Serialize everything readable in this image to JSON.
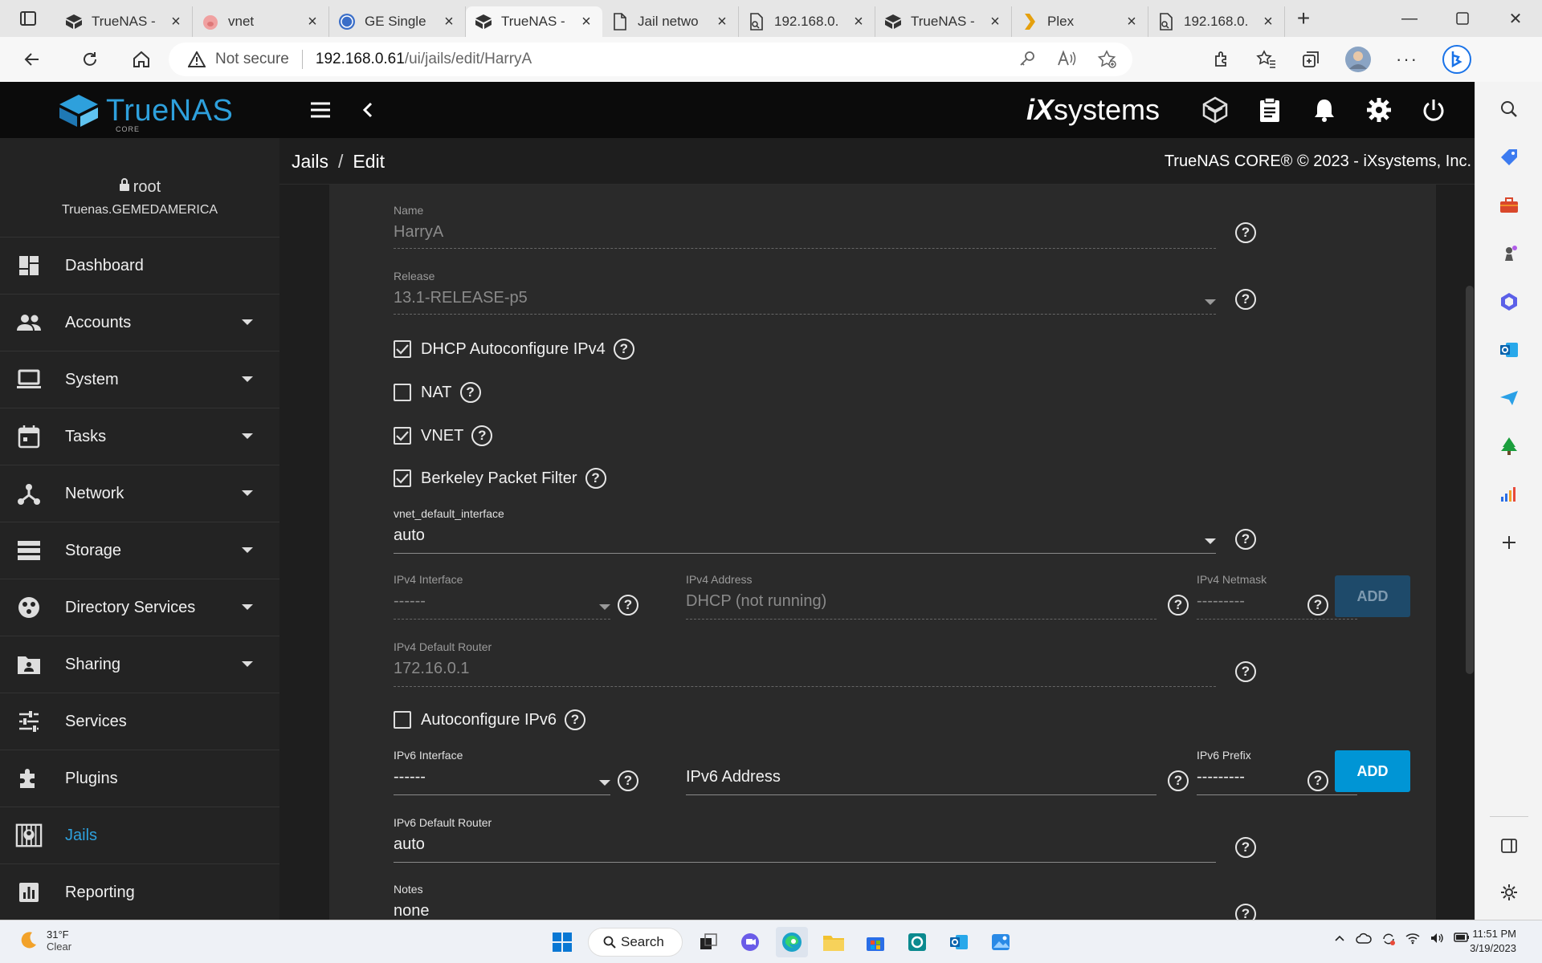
{
  "browser": {
    "tabs": [
      {
        "title": "TrueNAS - ",
        "icon": "truenas-icon",
        "active": false
      },
      {
        "title": "vnet",
        "icon": "pig-icon",
        "active": false
      },
      {
        "title": "GE Single",
        "icon": "ge-icon",
        "active": false
      },
      {
        "title": "TrueNAS - ",
        "icon": "truenas-icon",
        "active": true
      },
      {
        "title": "Jail netwo",
        "icon": "document-icon",
        "active": false
      },
      {
        "title": "192.168.0.",
        "icon": "broken-page-icon",
        "active": false
      },
      {
        "title": "TrueNAS - ",
        "icon": "truenas-icon",
        "active": false
      },
      {
        "title": "Plex",
        "icon": "plex-icon",
        "active": false
      },
      {
        "title": "192.168.0.",
        "icon": "broken-page-icon",
        "active": false
      }
    ],
    "security": "Not secure",
    "url_host": "192.168.0.61",
    "url_path": "/ui/jails/edit/HarryA"
  },
  "truenas": {
    "brand": "TrueNAS",
    "edition": "CORE",
    "vendor_logo_i": "iX",
    "vendor_logo_rest": "systems",
    "user": {
      "name": "root",
      "host": "Truenas.GEMEDAMERICA"
    },
    "nav": [
      {
        "label": "Dashboard",
        "icon": "dashboard-icon",
        "has_children": false
      },
      {
        "label": "Accounts",
        "icon": "accounts-icon",
        "has_children": true
      },
      {
        "label": "System",
        "icon": "system-icon",
        "has_children": true
      },
      {
        "label": "Tasks",
        "icon": "tasks-icon",
        "has_children": true
      },
      {
        "label": "Network",
        "icon": "network-icon",
        "has_children": true
      },
      {
        "label": "Storage",
        "icon": "storage-icon",
        "has_children": true
      },
      {
        "label": "Directory Services",
        "icon": "directory-services-icon",
        "has_children": true
      },
      {
        "label": "Sharing",
        "icon": "sharing-icon",
        "has_children": true
      },
      {
        "label": "Services",
        "icon": "services-icon",
        "has_children": false
      },
      {
        "label": "Plugins",
        "icon": "plugins-icon",
        "has_children": false
      },
      {
        "label": "Jails",
        "icon": "jails-icon",
        "has_children": false,
        "active": true
      },
      {
        "label": "Reporting",
        "icon": "reporting-icon",
        "has_children": false
      }
    ],
    "breadcrumb": {
      "parent": "Jails",
      "separator": "/",
      "current": "Edit"
    },
    "copyright": "TrueNAS CORE® © 2023 - iXsystems, Inc."
  },
  "form": {
    "name": {
      "label": "Name",
      "value": "HarryA"
    },
    "release": {
      "label": "Release",
      "value": "13.1-RELEASE-p5"
    },
    "dhcp": {
      "label": "DHCP Autoconfigure IPv4",
      "checked": true
    },
    "nat": {
      "label": "NAT",
      "checked": false
    },
    "vnet": {
      "label": "VNET",
      "checked": true
    },
    "bpf": {
      "label": "Berkeley Packet Filter",
      "checked": true
    },
    "vnet_default_interface": {
      "label": "vnet_default_interface",
      "value": "auto"
    },
    "ipv4_interface": {
      "label": "IPv4 Interface",
      "value": "------"
    },
    "ipv4_address": {
      "label": "IPv4 Address",
      "value": "DHCP (not running)"
    },
    "ipv4_netmask": {
      "label": "IPv4 Netmask",
      "value": "---------"
    },
    "ipv4_add": "ADD",
    "ipv4_default_router": {
      "label": "IPv4 Default Router",
      "value": "172.16.0.1"
    },
    "autoconf_ipv6": {
      "label": "Autoconfigure IPv6",
      "checked": false
    },
    "ipv6_interface": {
      "label": "IPv6 Interface",
      "value": "------"
    },
    "ipv6_address": {
      "placeholder": "IPv6 Address"
    },
    "ipv6_prefix": {
      "label": "IPv6 Prefix",
      "value": "---------"
    },
    "ipv6_add": "ADD",
    "ipv6_default_router": {
      "label": "IPv6 Default Router",
      "value": "auto"
    },
    "notes": {
      "label": "Notes",
      "value": "none"
    },
    "help_glyph": "?"
  },
  "taskbar": {
    "temperature": "31°F",
    "condition": "Clear",
    "search_label": "Search",
    "time": "11:51 PM",
    "date": "3/19/2023"
  }
}
